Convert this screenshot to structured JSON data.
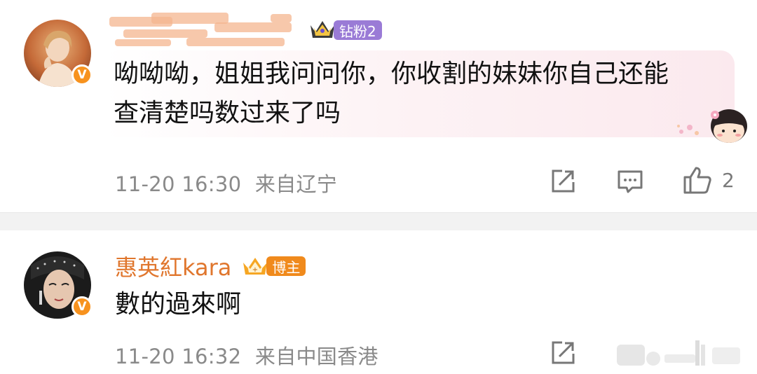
{
  "comments": [
    {
      "username": "",
      "badge": "钻粉2",
      "text_line1": "呦呦呦，姐姐我问问你，你收割的妹妹你自己还能",
      "text_line2": "查清楚吗数过来了吗",
      "timestamp": "11-20 16:30",
      "location": "来自辽宁",
      "like_count": "2",
      "verified": "V"
    },
    {
      "username": "惠英紅kara",
      "badge": "博主",
      "text_line1": "數的過來啊",
      "timestamp": "11-20 16:32",
      "location": "来自中国香港",
      "verified": "V"
    }
  ],
  "icons": {
    "share": "share-icon",
    "comment": "comment-icon",
    "like": "thumbs-up-icon",
    "badge_crown": "crown-icon",
    "sticker": "cartoon-girl-sticker"
  },
  "colors": {
    "username": "#e0762d",
    "meta_text": "#8a8a8a",
    "badge_purple": "#9a7bd6",
    "badge_orange": "#f08a1c",
    "verified": "#f7921e",
    "divider": "#f2f2f2"
  }
}
